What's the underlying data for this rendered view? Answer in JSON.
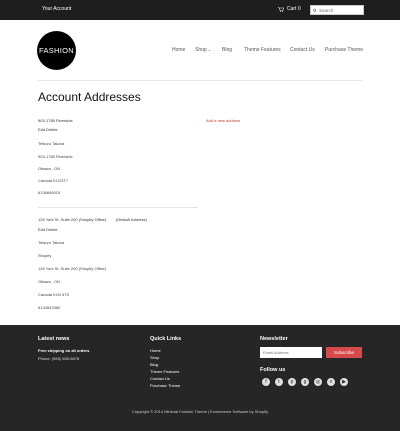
{
  "topbar": {
    "account_label": "Your Account",
    "cart_label": "Cart 0",
    "search_placeholder": "Search"
  },
  "header": {
    "logo_text": "FASHION",
    "nav": [
      "Home",
      "Shop",
      "Blog",
      "Theme Features",
      "Contact Us",
      "Purchase Theme"
    ]
  },
  "main": {
    "title": "Account Addresses",
    "add_new_label": "Add a new address",
    "addresses": [
      {
        "heading": "903-1785 Riverside",
        "edit_delete": "Edit Delete",
        "lines": [
          "Tetsuro Takara",
          "903-1785 Riverside",
          "Ottawa , ON",
          "Canada K1G3T7",
          "6136846015"
        ]
      },
      {
        "heading": "126 York St, Suite 200 (Shopify Office)",
        "default_label": "(Default Address)",
        "edit_delete": "Edit Delete",
        "lines": [
          "Tetsuro Takara",
          "Shopify",
          "126 York St, Suite 200 (Shopify Office)",
          "Ottawa , ON",
          "Canada K1N 5T5",
          "6134543380"
        ]
      }
    ]
  },
  "footer": {
    "latest_news": {
      "title": "Latest news",
      "headline": "Free shipping on all orders",
      "phone": "Phone: (555) 555-5678"
    },
    "quick_links": {
      "title": "Quick Links",
      "items": [
        "Home",
        "Shop",
        "Blog",
        "Theme Features",
        "Contact Us",
        "Purchase Theme"
      ]
    },
    "newsletter": {
      "title": "Newsletter",
      "placeholder": "Email Address",
      "button": "Subscribe",
      "follow_title": "Follow us",
      "social": [
        "facebook-icon",
        "twitter-icon",
        "pinterest-icon",
        "google-plus-icon",
        "instagram-icon",
        "vimeo-icon",
        "youtube-icon"
      ]
    },
    "copyright": "Copyright © 2014 Minimal Fashion Theme | Ecommerce Software by Shopify"
  },
  "colors": {
    "topbar_bg": "#1e1e1e",
    "footer_bg": "#262626",
    "accent": "#c0392b",
    "subscribe_bg": "#d64a4a"
  }
}
